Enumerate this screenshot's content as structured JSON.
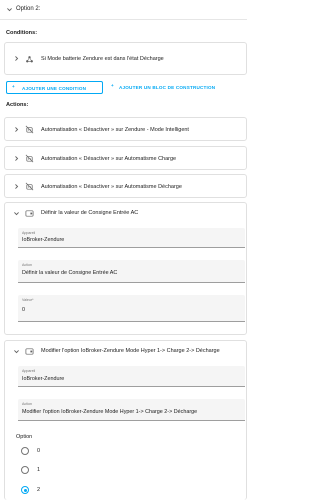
{
  "option": {
    "title": "Option 2:"
  },
  "conditions": {
    "heading": "Conditions:",
    "items": [
      {
        "label": "Si Mode batterie Zendure est dans l'état Décharge",
        "icon": "cluster-icon"
      }
    ],
    "add_condition_label": "AJOUTER UNE CONDITION",
    "add_block_label": "AJOUTER UN BLOC DE CONSTRUCTION"
  },
  "actions": {
    "heading": "Actions:",
    "items": [
      {
        "label": "Automatisation « Désactiver » sur Zendure - Mode Intelligent",
        "icon": "robot-off-icon"
      },
      {
        "label": "Automatisation « Désactiver » sur Automatisme Charge",
        "icon": "robot-off-icon"
      },
      {
        "label": "Automatisation « Désactiver » sur Automatisme Décharge",
        "icon": "robot-off-icon"
      }
    ],
    "consigne": {
      "title": "Définir la valeur de Consigne Entrée AC",
      "appareil_label": "Appareil",
      "appareil_value": "IoBroker-Zendure",
      "action_label": "Action",
      "action_value": "Définir la valeur de Consigne Entrée AC",
      "valeur_label": "Valeur*",
      "valeur_value": "0"
    },
    "modifier": {
      "title": "Modifier l'option IoBroker-Zendure Mode Hyper 1-> Charge 2-> Décharge",
      "appareil_label": "Appareil",
      "appareil_value": "IoBroker-Zendure",
      "action_label": "Action",
      "action_value": "Modifier l'option IoBroker-Zendure Mode Hyper 1-> Charge 2-> Décharge",
      "option_heading": "Option",
      "options": [
        "0",
        "1",
        "2"
      ],
      "selected": "2"
    }
  },
  "colors": {
    "accent": "#03a9f4",
    "text": "#212121",
    "muted": "#757575"
  }
}
